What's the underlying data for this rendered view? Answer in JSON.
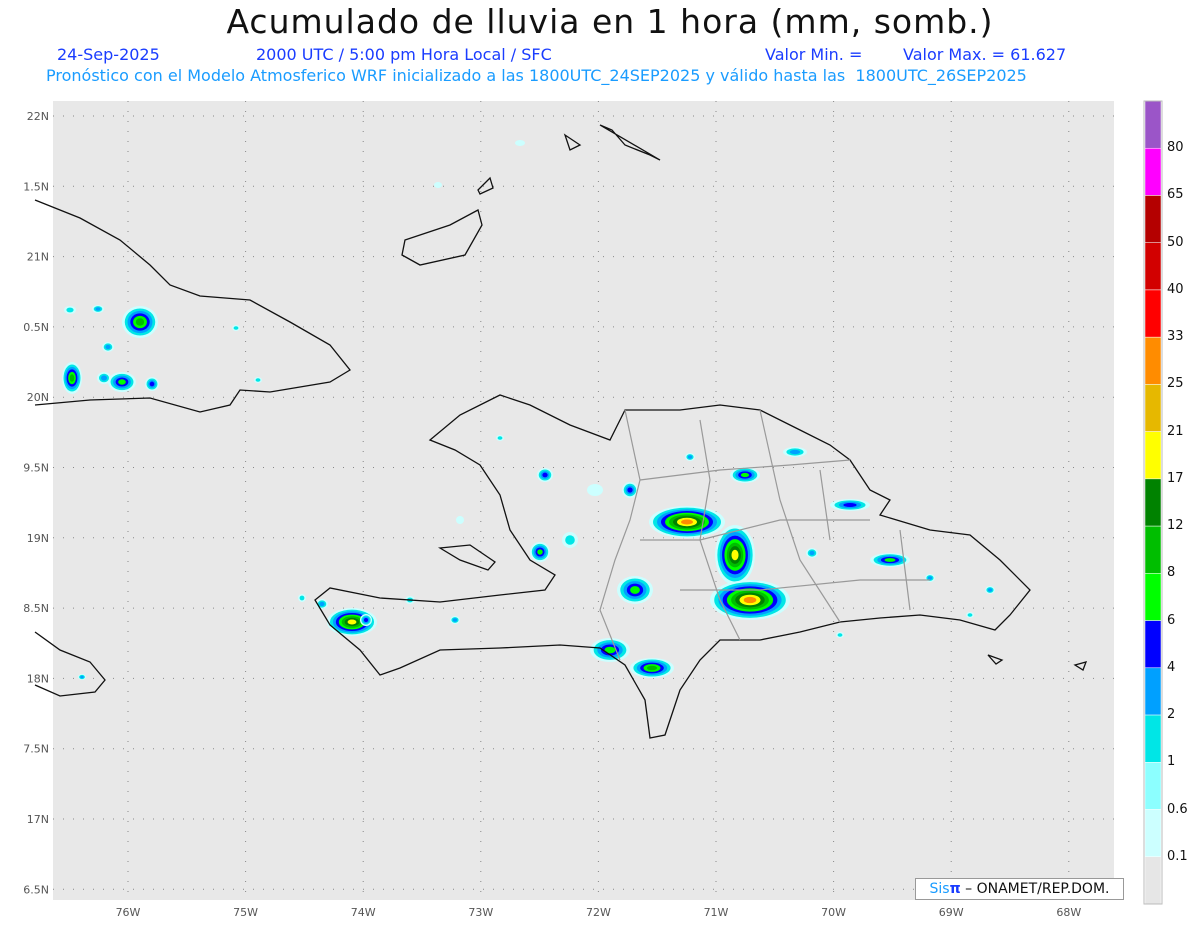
{
  "header": {
    "title": "Acumulado de lluvia en 1 hora (mm, somb.)",
    "date": "24-Sep-2025",
    "time": "2000 UTC / 5:00 pm Hora Local / SFC",
    "min_label": "Valor Min. =",
    "max_label": "Valor Max. = 61.627",
    "model_line": "Pronóstico con el Modelo Atmosferico WRF inicializado a las 1800UTC_24SEP2025 y válido hasta las  1800UTC_26SEP2025"
  },
  "axes": {
    "lat_labels": [
      "22N",
      "1.5N",
      "21N",
      "0.5N",
      "20N",
      "9.5N",
      "19N",
      "8.5N",
      "18N",
      "7.5N",
      "17N",
      "6.5N"
    ],
    "lon_labels": [
      "76W",
      "75W",
      "74W",
      "73W",
      "72W",
      "71W",
      "70W",
      "69W",
      "68W"
    ]
  },
  "colorbar": {
    "labels": [
      "80",
      "65",
      "50",
      "40",
      "33",
      "25",
      "21",
      "17",
      "12",
      "8",
      "6",
      "4",
      "2",
      "1",
      "0.6",
      "0.1"
    ],
    "colors": [
      "#9b55c8",
      "#ff00ff",
      "#b40000",
      "#d20000",
      "#ff0000",
      "#ff8c00",
      "#e6b800",
      "#ffff00",
      "#008200",
      "#00be00",
      "#00ff00",
      "#0000ff",
      "#00a0ff",
      "#00e6e6",
      "#8cffff",
      "#ccffff",
      "#e6e6e6"
    ]
  },
  "credit": {
    "sis": "Sis",
    "pi": "π",
    "org": "– ONAMET/REP.DOM."
  }
}
